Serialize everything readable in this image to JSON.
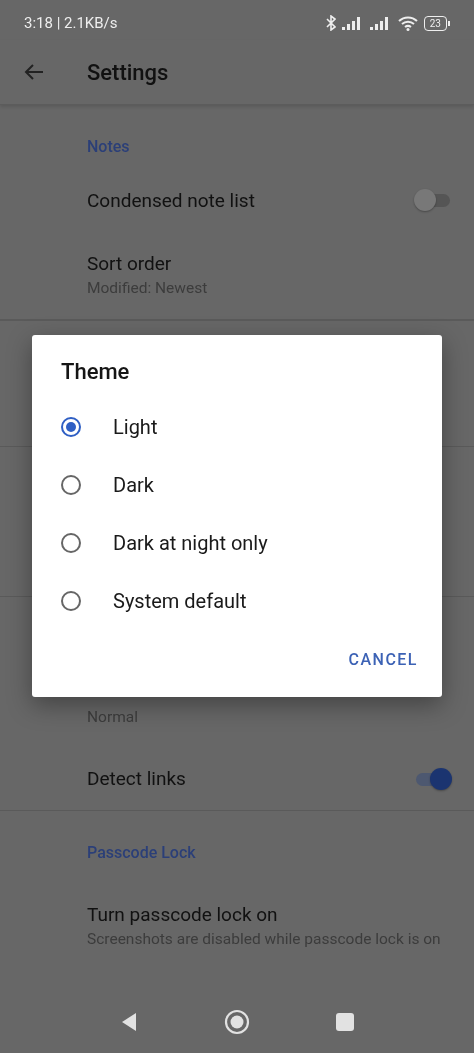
{
  "status_bar": {
    "time": "3:18 | 2.1KB/s",
    "battery": "23"
  },
  "app_bar": {
    "title": "Settings"
  },
  "settings_above": [
    {
      "kind": "header",
      "title": "Notes"
    },
    {
      "kind": "toggle",
      "title": "Condensed note list",
      "on": false
    },
    {
      "kind": "text",
      "title": "Sort order",
      "subtitle": "Modified: Newest"
    }
  ],
  "settings_below": [
    {
      "kind": "subtitle",
      "subtitle": "Normal"
    },
    {
      "kind": "toggle",
      "title": "Detect links",
      "on": true
    },
    {
      "kind": "header",
      "title": "Passcode Lock"
    },
    {
      "kind": "text",
      "title": "Turn passcode lock on",
      "subtitle": "Screenshots are disabled while passcode lock is on"
    }
  ],
  "theme_dialog": {
    "title": "Theme",
    "options": [
      {
        "label": "Light",
        "selected": true
      },
      {
        "label": "Dark",
        "selected": false
      },
      {
        "label": "Dark at night only",
        "selected": false
      },
      {
        "label": "System default",
        "selected": false
      }
    ],
    "cancel": "CANCEL"
  }
}
